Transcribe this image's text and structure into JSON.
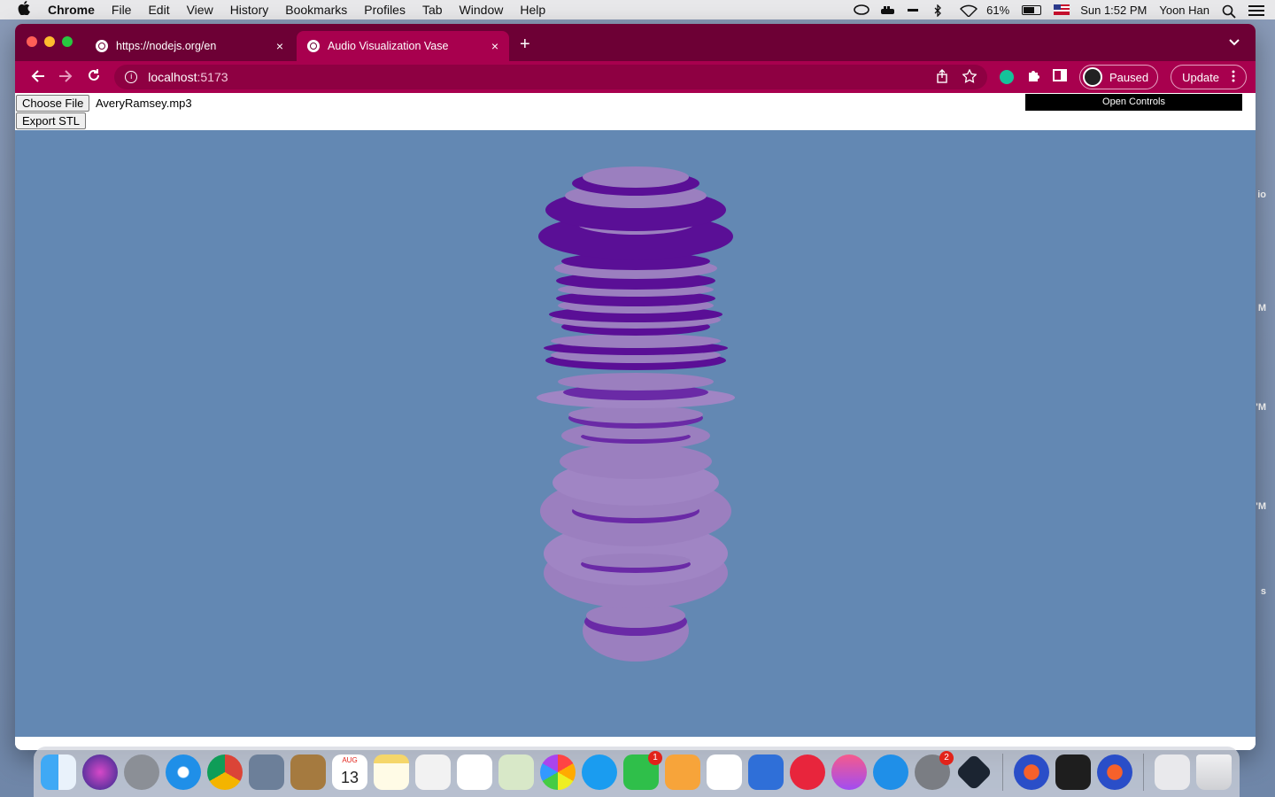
{
  "menubar": {
    "apple": "",
    "items": [
      "Chrome",
      "File",
      "Edit",
      "View",
      "History",
      "Bookmarks",
      "Profiles",
      "Tab",
      "Window",
      "Help"
    ],
    "battery": "61%",
    "datetime": "Sun 1:52 PM",
    "user": "Yoon Han"
  },
  "browser": {
    "tabs": [
      {
        "title": "https://nodejs.org/en",
        "close": "×"
      },
      {
        "title": "Audio Visualization Vase",
        "close": "×"
      }
    ],
    "new_tab": "+",
    "url_host": "localhost",
    "url_port": ":5173",
    "profile_status": "Paused",
    "update_label": "Update"
  },
  "page": {
    "choose_file_label": "Choose File",
    "file_name": "AveryRamsey.mp3",
    "export_label": "Export STL",
    "open_controls_label": "Open Controls"
  },
  "desktop_labels": [
    "io",
    "M",
    "'M",
    "'M",
    "s"
  ],
  "dock": {
    "calendar_month": "AUG",
    "calendar_day": "13",
    "facetime_badge": "1",
    "settings_badge": "2"
  },
  "colors": {
    "tab_strip": "#6d0035",
    "toolbar": "#a8004e",
    "scene_background": "#6388b3",
    "vase_light": "#9b7fbf",
    "vase_dark": "#5a0f96"
  }
}
